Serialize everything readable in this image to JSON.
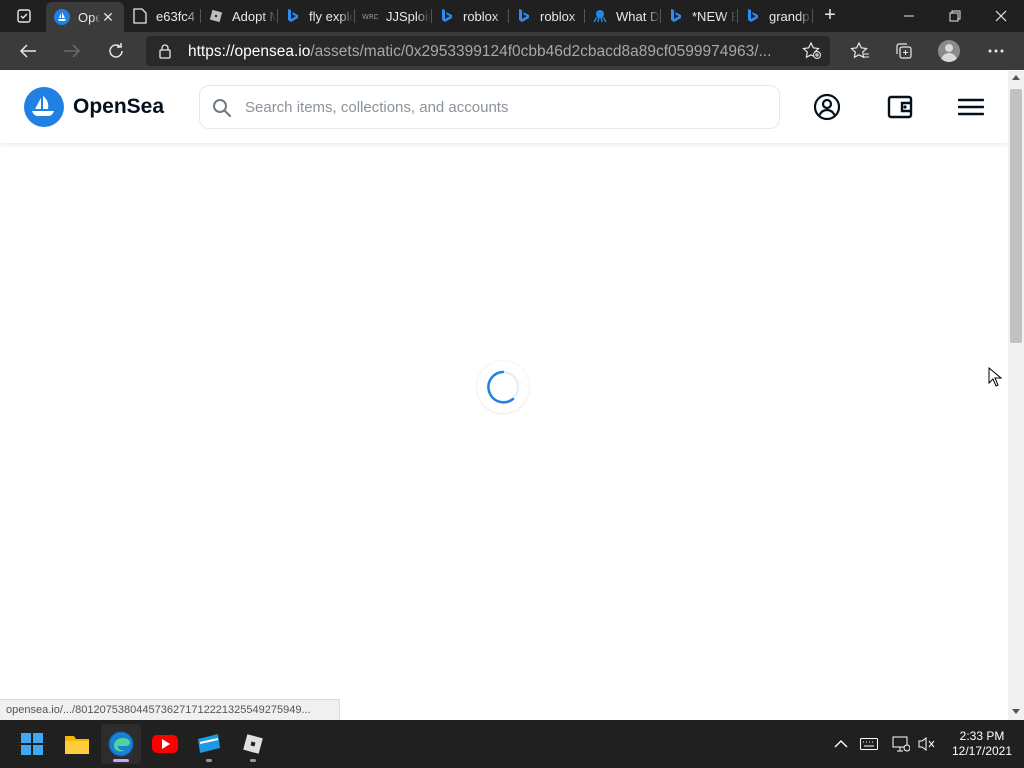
{
  "browser": {
    "tabs": [
      {
        "title": "OpenSea",
        "active": true,
        "icon": "opensea-icon"
      },
      {
        "title": "e63fc4",
        "active": false,
        "icon": "page-icon"
      },
      {
        "title": "Adopt Me",
        "active": false,
        "icon": "roblox-icon"
      },
      {
        "title": "fly exploit",
        "active": false,
        "icon": "bing-icon"
      },
      {
        "title": "JJSploit",
        "active": false,
        "icon": "jjsploit-icon"
      },
      {
        "title": "roblox",
        "active": false,
        "icon": "bing-icon"
      },
      {
        "title": "roblox",
        "active": false,
        "icon": "bing-icon"
      },
      {
        "title": "What D",
        "active": false,
        "icon": "octopus-icon"
      },
      {
        "title": "*NEW E",
        "active": false,
        "icon": "bing-icon"
      },
      {
        "title": "grandp",
        "active": false,
        "icon": "bing-icon"
      }
    ],
    "address": {
      "host": "https://opensea.io",
      "path": "/assets/matic/0x2953399124f0cbb46d2cbacd8a89cf0599974963/..."
    },
    "status_url": "opensea.io/.../801207538044573627171222132554927594​9..."
  },
  "opensea": {
    "brand": "OpenSea",
    "search_placeholder": "Search items, collections, and accounts",
    "brand_color": "#2081e2"
  },
  "taskbar": {
    "apps": [
      "windows-start",
      "file-explorer",
      "edge",
      "youtube",
      "app-blue",
      "roblox"
    ],
    "time": "2:33 PM",
    "date": "12/17/2021"
  }
}
